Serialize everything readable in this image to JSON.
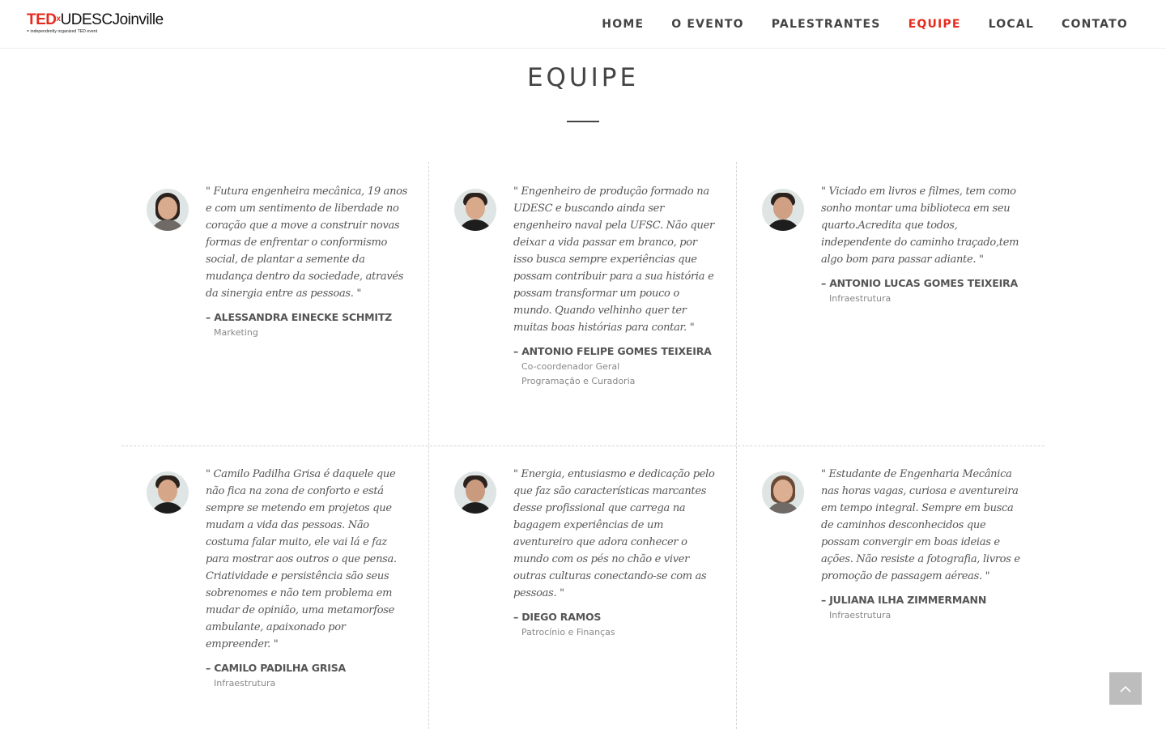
{
  "logo": {
    "ted": "TED",
    "x": "x",
    "name": "UDESCJoinville",
    "x_small": "x",
    "tagline": "= independently organized TED event"
  },
  "nav": {
    "items": [
      {
        "label": "HOME",
        "active": false
      },
      {
        "label": "O EVENTO",
        "active": false
      },
      {
        "label": "PALESTRANTES",
        "active": false
      },
      {
        "label": "EQUIPE",
        "active": true
      },
      {
        "label": "LOCAL",
        "active": false
      },
      {
        "label": "CONTATO",
        "active": false
      }
    ]
  },
  "section": {
    "title": "EQUIPE"
  },
  "team": [
    {
      "quote": "\" Futura engenheira mecânica, 19 anos e com um sentimento de liberdade no coração que a move a construir novas formas de enfrentar o conformismo social, de plantar a semente da mudança dentro da sociedade, através da sinergia entre as pessoas. \"",
      "name": "– ALESSANDRA EINECKE SCHMITZ",
      "roles": [
        "Marketing"
      ]
    },
    {
      "quote": "\" Engenheiro de produção formado na UDESC e buscando ainda ser engenheiro naval pela UFSC. Não quer deixar a vida passar em branco, por isso busca sempre experiências que possam contribuir para a sua história e possam transformar um pouco o mundo. Quando velhinho quer ter muitas boas histórias para contar. \"",
      "name": "– ANTONIO FELIPE GOMES TEIXEIRA",
      "roles": [
        "Co-coordenador Geral",
        "Programação e Curadoria"
      ]
    },
    {
      "quote": "\" Viciado em livros e filmes, tem como sonho montar uma biblioteca em seu quarto.Acredita que todos, independente do caminho traçado,tem algo bom para passar adiante. \"",
      "name": "– ANTONIO LUCAS GOMES TEIXEIRA",
      "roles": [
        "Infraestrutura"
      ]
    },
    {
      "quote": "\" Camilo Padilha Grisa é daquele que não fica na zona de conforto e está sempre se metendo em projetos que mudam a vida das pessoas. Não costuma falar muito, ele vai lá e faz para mostrar aos outros o que pensa. Criatividade e persistência são seus sobrenomes e não tem problema em mudar de opinião, uma metamorfose ambulante, apaixonado por empreender. \"",
      "name": "– CAMILO PADILHA GRISA",
      "roles": [
        "Infraestrutura"
      ]
    },
    {
      "quote": "\" Energia, entusiasmo e dedicação pelo que faz são características marcantes desse profissional que carrega na bagagem experiências de um aventureiro que adora conhecer o mundo com os pés no chão e viver outras culturas conectando-se com as pessoas. \"",
      "name": "– DIEGO RAMOS",
      "roles": [
        "Patrocínio e Finanças"
      ]
    },
    {
      "quote": "\" Estudante de Engenharia Mecânica nas horas vagas, curiosa e aventureira em tempo integral. Sempre em busca de caminhos desconhecidos que possam convergir em boas ideias e ações. Não resiste a fotografia, livros e promoção de passagem aéreas. \"",
      "name": "– JULIANA ILHA ZIMMERMANN",
      "roles": [
        "Infraestrutura"
      ]
    }
  ],
  "colors": {
    "accent": "#e62b1e",
    "text": "#444444",
    "muted": "#888888",
    "divider": "#d6d6d6",
    "to_top_bg": "#bdbdbd"
  },
  "icons": {
    "to_top": "chevron-up-icon"
  }
}
